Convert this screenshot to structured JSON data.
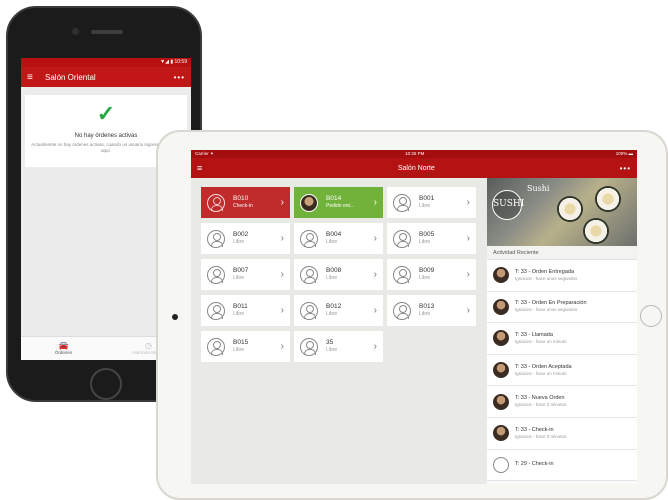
{
  "phone": {
    "status_time": "▼◢ ▮ 10:59",
    "title": "Salón Oriental",
    "more": "•••",
    "empty_title": "No hay órdenes activas",
    "empty_desc": "Actualmente no hay órdenes activas, cuando un usuario ingrese aparecerá aquí.",
    "tabs": [
      {
        "label": "Órdenes",
        "icon": "car-icon"
      },
      {
        "label": "Atención Mesas",
        "icon": "clock-icon"
      }
    ]
  },
  "ipad": {
    "status_left": "Carrier ✦",
    "status_time": "10:26 PM",
    "status_right": "100% ▬",
    "title": "Salón Norte",
    "more": "•••",
    "tables": [
      {
        "name": "B010",
        "status": "Check-in",
        "state": "checkin"
      },
      {
        "name": "B014",
        "status": "Pedido ent...",
        "state": "pedido"
      },
      {
        "name": "B001",
        "status": "Libre",
        "state": "libre"
      },
      {
        "name": "B002",
        "status": "Libre",
        "state": "libre"
      },
      {
        "name": "B004",
        "status": "Libre",
        "state": "libre"
      },
      {
        "name": "B005",
        "status": "Libre",
        "state": "libre"
      },
      {
        "name": "B007",
        "status": "Libre",
        "state": "libre"
      },
      {
        "name": "B008",
        "status": "Libre",
        "state": "libre"
      },
      {
        "name": "B009",
        "status": "Libre",
        "state": "libre"
      },
      {
        "name": "B011",
        "status": "Libre",
        "state": "libre"
      },
      {
        "name": "B012",
        "status": "Libre",
        "state": "libre"
      },
      {
        "name": "B013",
        "status": "Libre",
        "state": "libre"
      },
      {
        "name": "B015",
        "status": "Libre",
        "state": "libre"
      },
      {
        "name": "35",
        "status": "Libre",
        "state": "libre"
      }
    ],
    "banner": {
      "name": "Sushi",
      "logo": "SUSHI"
    },
    "activity_header": "Actividad Reciente",
    "activity": [
      {
        "title": "T: 33 - Orden Entregada",
        "sub": "Ignacios - hace unos segundos"
      },
      {
        "title": "T: 33 - Orden En Preparación",
        "sub": "Ignacios - hace unos segundos"
      },
      {
        "title": "T: 33 - Llamada",
        "sub": "Ignacios - hace un minuto"
      },
      {
        "title": "T: 33 - Orden Aceptada",
        "sub": "Ignacios - hace un minuto"
      },
      {
        "title": "T: 33 - Nueva Orden",
        "sub": "Ignacios - hace 2 minutos"
      },
      {
        "title": "T: 33 - Check-in",
        "sub": "Ignacios - hace 3 minutos"
      },
      {
        "title": "T: 29 - Check-in",
        "sub": ""
      }
    ]
  },
  "colors": {
    "brand_red": "#c11717",
    "checkin_red": "#c02b2b",
    "pedido_green": "#71b23a",
    "check_green": "#27a844"
  }
}
